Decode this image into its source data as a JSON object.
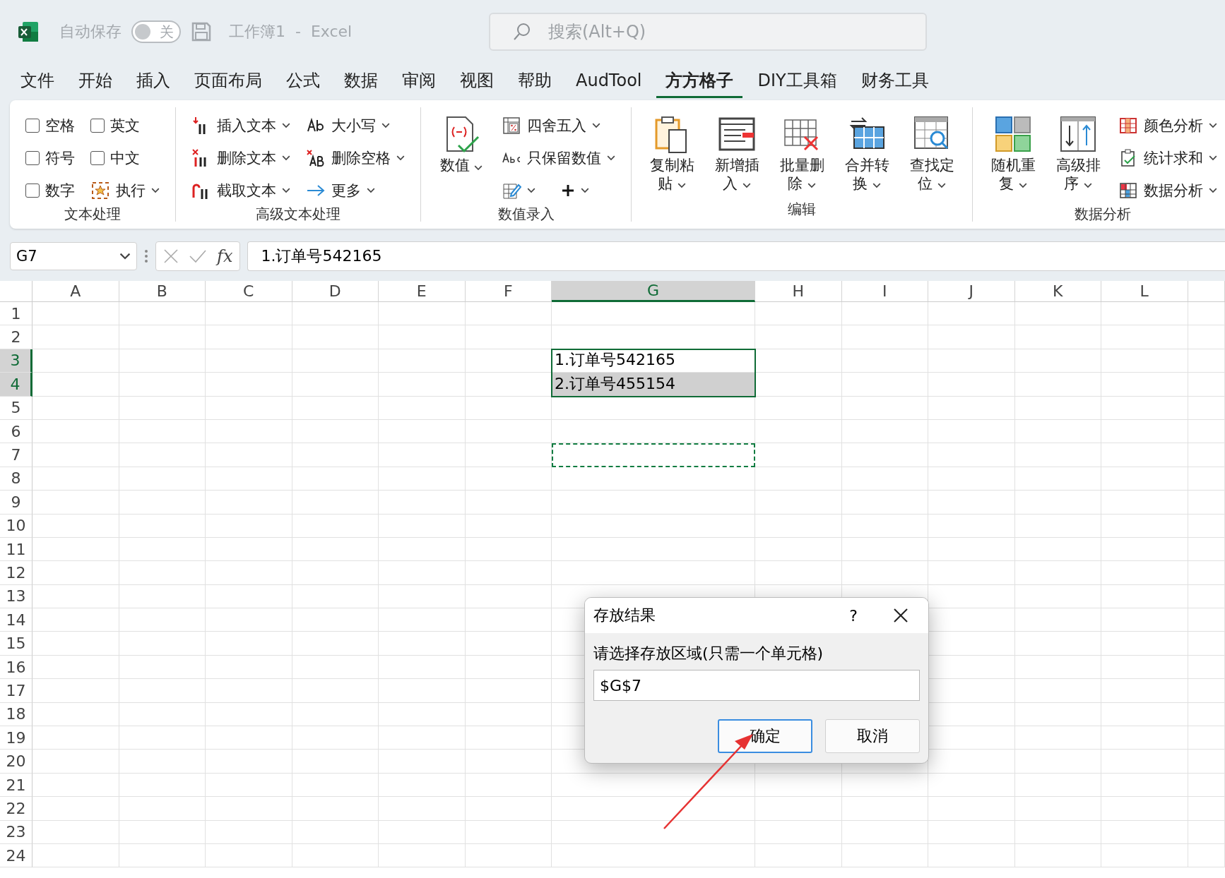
{
  "title_bar": {
    "autosave_label": "自动保存",
    "autosave": {
      "on": false,
      "label": "关"
    },
    "document_title": "工作簿1  -  Excel",
    "search": {
      "placeholder": "搜索(Alt+Q)"
    }
  },
  "menu_tabs": [
    {
      "label": "文件",
      "selected": false
    },
    {
      "label": "开始",
      "selected": false
    },
    {
      "label": "插入",
      "selected": false
    },
    {
      "label": "页面布局",
      "selected": false
    },
    {
      "label": "公式",
      "selected": false
    },
    {
      "label": "数据",
      "selected": false
    },
    {
      "label": "审阅",
      "selected": false
    },
    {
      "label": "视图",
      "selected": false
    },
    {
      "label": "帮助",
      "selected": false
    },
    {
      "label": "AudTool",
      "selected": false
    },
    {
      "label": "方方格子",
      "selected": true
    },
    {
      "label": "DIY工具箱",
      "selected": false
    },
    {
      "label": "财务工具",
      "selected": false
    }
  ],
  "ribbon": {
    "groups": [
      {
        "label": "文本处理",
        "columns": [
          [
            {
              "kind": "checkbox",
              "label": "空格",
              "checked": false
            },
            {
              "kind": "checkbox",
              "label": "符号",
              "checked": false
            },
            {
              "kind": "checkbox",
              "label": "数字",
              "checked": false
            }
          ],
          [
            {
              "kind": "checkbox",
              "label": "英文",
              "checked": false
            },
            {
              "kind": "checkbox",
              "label": "中文",
              "checked": false
            },
            {
              "kind": "menu",
              "label": "执行"
            }
          ]
        ]
      },
      {
        "label": "高级文本处理",
        "columns": [
          [
            {
              "kind": "menu",
              "label": "插入文本"
            },
            {
              "kind": "menu",
              "label": "删除文本"
            },
            {
              "kind": "menu",
              "label": "截取文本"
            }
          ],
          [
            {
              "kind": "menu",
              "label": "大小写"
            },
            {
              "kind": "menu",
              "label": "删除空格"
            },
            {
              "kind": "menu",
              "label": "更多"
            }
          ]
        ]
      },
      {
        "label": "数值录入",
        "columns": [
          [
            {
              "kind": "large",
              "label": "数值"
            }
          ],
          [
            {
              "kind": "menu",
              "label": "四舍五入"
            },
            {
              "kind": "menu",
              "label": "只保留数值"
            },
            {
              "kind": "icon_row"
            }
          ]
        ]
      },
      {
        "label": "编辑",
        "columns": [
          [
            {
              "kind": "large",
              "label": "复制粘贴"
            }
          ],
          [
            {
              "kind": "large",
              "label": "新增插入"
            }
          ],
          [
            {
              "kind": "large",
              "label": "批量删除"
            }
          ],
          [
            {
              "kind": "large",
              "label": "合并转换"
            }
          ],
          [
            {
              "kind": "large",
              "label": "查找定位"
            }
          ]
        ]
      },
      {
        "label": "数据分析",
        "columns": [
          [
            {
              "kind": "large",
              "label": "随机重复"
            }
          ],
          [
            {
              "kind": "large",
              "label": "高级排序"
            }
          ],
          [
            {
              "kind": "menu",
              "label": "颜色分析"
            },
            {
              "kind": "menu",
              "label": "统计求和"
            },
            {
              "kind": "menu",
              "label": "数据分析"
            }
          ]
        ]
      }
    ]
  },
  "formula_bar": {
    "name_box": "G7",
    "fx": "fx",
    "formula": "1.订单号542165"
  },
  "sheet": {
    "columns": [
      {
        "label": "A",
        "selected": false
      },
      {
        "label": "B",
        "selected": false
      },
      {
        "label": "C",
        "selected": false
      },
      {
        "label": "D",
        "selected": false
      },
      {
        "label": "E",
        "selected": false
      },
      {
        "label": "F",
        "selected": false
      },
      {
        "label": "G",
        "selected": true
      },
      {
        "label": "H",
        "selected": false
      },
      {
        "label": "I",
        "selected": false
      },
      {
        "label": "J",
        "selected": false
      },
      {
        "label": "K",
        "selected": false
      },
      {
        "label": "L",
        "selected": false
      }
    ],
    "rows": [
      {
        "label": "1",
        "selected": false,
        "cells": [
          {},
          {},
          {},
          {},
          {},
          {},
          {},
          {},
          {},
          {},
          {},
          {}
        ]
      },
      {
        "label": "2",
        "selected": false,
        "cells": [
          {},
          {},
          {},
          {},
          {},
          {},
          {},
          {},
          {},
          {},
          {},
          {}
        ]
      },
      {
        "label": "3",
        "selected": true,
        "cells": [
          {},
          {},
          {},
          {},
          {},
          {},
          {
            "text": "1.订单号542165",
            "selected": false
          },
          {},
          {},
          {},
          {},
          {}
        ]
      },
      {
        "label": "4",
        "selected": true,
        "cells": [
          {},
          {},
          {},
          {},
          {},
          {},
          {
            "text": "2.订单号455154",
            "selected": true
          },
          {},
          {},
          {},
          {},
          {}
        ]
      },
      {
        "label": "5",
        "selected": false,
        "cells": [
          {},
          {},
          {},
          {},
          {},
          {},
          {},
          {},
          {},
          {},
          {},
          {}
        ]
      },
      {
        "label": "6",
        "selected": false,
        "cells": [
          {},
          {},
          {},
          {},
          {},
          {},
          {},
          {},
          {},
          {},
          {},
          {}
        ]
      },
      {
        "label": "7",
        "selected": false,
        "cells": [
          {},
          {},
          {},
          {},
          {},
          {},
          {
            "marquee": true
          },
          {},
          {},
          {},
          {},
          {}
        ]
      },
      {
        "label": "8",
        "selected": false,
        "cells": [
          {},
          {},
          {},
          {},
          {},
          {},
          {},
          {},
          {},
          {},
          {},
          {}
        ]
      },
      {
        "label": "9",
        "selected": false,
        "cells": [
          {},
          {},
          {},
          {},
          {},
          {},
          {},
          {},
          {},
          {},
          {},
          {}
        ]
      },
      {
        "label": "10",
        "selected": false,
        "cells": [
          {},
          {},
          {},
          {},
          {},
          {},
          {},
          {},
          {},
          {},
          {},
          {}
        ]
      },
      {
        "label": "11",
        "selected": false,
        "cells": [
          {},
          {},
          {},
          {},
          {},
          {},
          {},
          {},
          {},
          {},
          {},
          {}
        ]
      },
      {
        "label": "12",
        "selected": false,
        "cells": [
          {},
          {},
          {},
          {},
          {},
          {},
          {},
          {},
          {},
          {},
          {},
          {}
        ]
      },
      {
        "label": "13",
        "selected": false,
        "cells": [
          {},
          {},
          {},
          {},
          {},
          {},
          {},
          {},
          {},
          {},
          {},
          {}
        ]
      },
      {
        "label": "14",
        "selected": false,
        "cells": [
          {},
          {},
          {},
          {},
          {},
          {},
          {},
          {},
          {},
          {},
          {},
          {}
        ]
      },
      {
        "label": "15",
        "selected": false,
        "cells": [
          {},
          {},
          {},
          {},
          {},
          {},
          {},
          {},
          {},
          {},
          {},
          {}
        ]
      },
      {
        "label": "16",
        "selected": false,
        "cells": [
          {},
          {},
          {},
          {},
          {},
          {},
          {},
          {},
          {},
          {},
          {},
          {}
        ]
      },
      {
        "label": "17",
        "selected": false,
        "cells": [
          {},
          {},
          {},
          {},
          {},
          {},
          {},
          {},
          {},
          {},
          {},
          {}
        ]
      },
      {
        "label": "18",
        "selected": false,
        "cells": [
          {},
          {},
          {},
          {},
          {},
          {},
          {},
          {},
          {},
          {},
          {},
          {}
        ]
      },
      {
        "label": "19",
        "selected": false,
        "cells": [
          {},
          {},
          {},
          {},
          {},
          {},
          {},
          {},
          {},
          {},
          {},
          {}
        ]
      },
      {
        "label": "20",
        "selected": false,
        "cells": [
          {},
          {},
          {},
          {},
          {},
          {},
          {},
          {},
          {},
          {},
          {},
          {}
        ]
      },
      {
        "label": "21",
        "selected": false,
        "cells": [
          {},
          {},
          {},
          {},
          {},
          {},
          {},
          {},
          {},
          {},
          {},
          {}
        ]
      },
      {
        "label": "22",
        "selected": false,
        "cells": [
          {},
          {},
          {},
          {},
          {},
          {},
          {},
          {},
          {},
          {},
          {},
          {}
        ]
      },
      {
        "label": "23",
        "selected": false,
        "cells": [
          {},
          {},
          {},
          {},
          {},
          {},
          {},
          {},
          {},
          {},
          {},
          {}
        ]
      },
      {
        "label": "24",
        "selected": false,
        "cells": [
          {},
          {},
          {},
          {},
          {},
          {},
          {},
          {},
          {},
          {},
          {},
          {}
        ]
      }
    ]
  },
  "dialog": {
    "title": "存放结果",
    "help": "?",
    "prompt": "请选择存放区域(只需一个单元格)",
    "value": "$G$7",
    "buttons": [
      {
        "label": "确定",
        "default": true
      },
      {
        "label": "取消",
        "default": false
      }
    ]
  }
}
